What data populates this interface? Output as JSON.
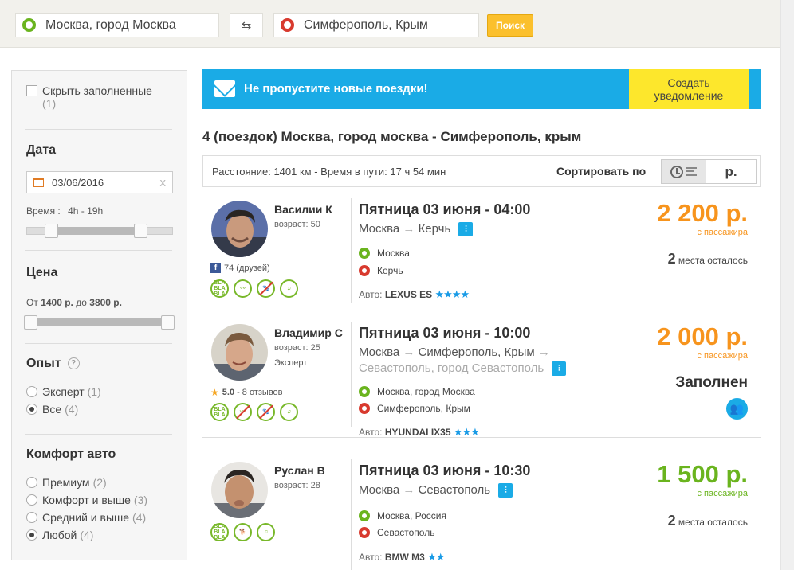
{
  "search": {
    "from": "Москва, город Москва",
    "to": "Симферополь, Крым",
    "swap_icon": "swap-arrows-icon",
    "button": "Поиск",
    "button_color": "#fbc02d"
  },
  "filters": {
    "hide_full_label": "Скрыть заполненные",
    "hide_full_count": "(1)",
    "date_title": "Дата",
    "date_value": "03/06/2016",
    "time_label": "Время :",
    "time_range": "4h - 19h",
    "price_title": "Цена",
    "price_prefix": "От",
    "price_min": "1400 р.",
    "price_mid": "до",
    "price_max": "3800 р.",
    "experience_title": "Опыт",
    "experience_help": "?",
    "experience_options": [
      {
        "label": "Эксперт",
        "count": "(1)",
        "selected": false
      },
      {
        "label": "Все",
        "count": "(4)",
        "selected": true
      }
    ],
    "comfort_title": "Комфорт авто",
    "comfort_options": [
      {
        "label": "Премиум",
        "count": "(2)",
        "selected": false
      },
      {
        "label": "Комфорт и выше",
        "count": "(3)",
        "selected": false
      },
      {
        "label": "Средний и выше",
        "count": "(4)",
        "selected": false
      },
      {
        "label": "Любой",
        "count": "(4)",
        "selected": true
      }
    ]
  },
  "banner": {
    "text": "Не пропустите новые поездки!",
    "button_line1": "Создать",
    "button_line2": "уведомление",
    "color": "#1aabe6"
  },
  "results": {
    "title": "4 (поездок) Москва, город москва - Симферополь, крым",
    "info": "Расстояние: 1401 км - Время в пути: 17 ч 54 мин",
    "sort_label": "Сортировать по",
    "sort_price_label": "р."
  },
  "trips": [
    {
      "name": "Василии К",
      "age": "возраст: 50",
      "friends": "74 (друзей)",
      "date": "Пятница 03 июня - 04:00",
      "route_from": "Москва",
      "route_arrow": "→",
      "route_to": "Керчь",
      "stop_from": "Москва",
      "stop_to": "Керчь",
      "car_label": "Авто:",
      "car": "LEXUS ES",
      "car_stars": "★★★★",
      "price": "2 200 р.",
      "price_color": "#f7941d",
      "per_passenger": "с пассажира",
      "seats_num": "2",
      "seats_text": "места осталось"
    },
    {
      "name": "Владимир С",
      "age": "возраст: 25",
      "level": "Эксперт",
      "rating": "5.0",
      "reviews": "- 8 отзывов",
      "date": "Пятница 03 июня - 10:00",
      "route_from": "Москва",
      "route_arrow": "→",
      "route_mid": "Симферополь, Крым",
      "route_arrow2": "→",
      "route_to": "Севастополь, город Севастополь",
      "stop_from": "Москва, город Москва",
      "stop_to": "Симферополь, Крым",
      "car_label": "Авто:",
      "car": "HYUNDAI IX35",
      "car_stars": "★★★",
      "price": "2 000 р.",
      "price_color": "#f7941d",
      "per_passenger": "с пассажира",
      "full": "Заполнен"
    },
    {
      "name": "Руслан В",
      "age": "возраст: 28",
      "date": "Пятница 03 июня - 10:30",
      "route_from": "Москва",
      "route_arrow": "→",
      "route_to": "Севастополь",
      "stop_from": "Москва, Россия",
      "stop_to": "Севастополь",
      "car_label": "Авто:",
      "car": "BMW M3",
      "car_stars": "★★",
      "price": "1 500 р.",
      "price_color": "#6ab41e",
      "per_passenger": "с пассажира",
      "seats_num": "2",
      "seats_text": "места осталось"
    }
  ],
  "pref_icons": {
    "chat": "BLA BLA BLA",
    "chat_short": "BLA BLA"
  },
  "colors": {
    "origin": "#6ab41e",
    "destination": "#d83a2e",
    "accent_blue": "#1aabe6",
    "price_orange": "#f7941d",
    "price_green": "#6ab41e"
  }
}
